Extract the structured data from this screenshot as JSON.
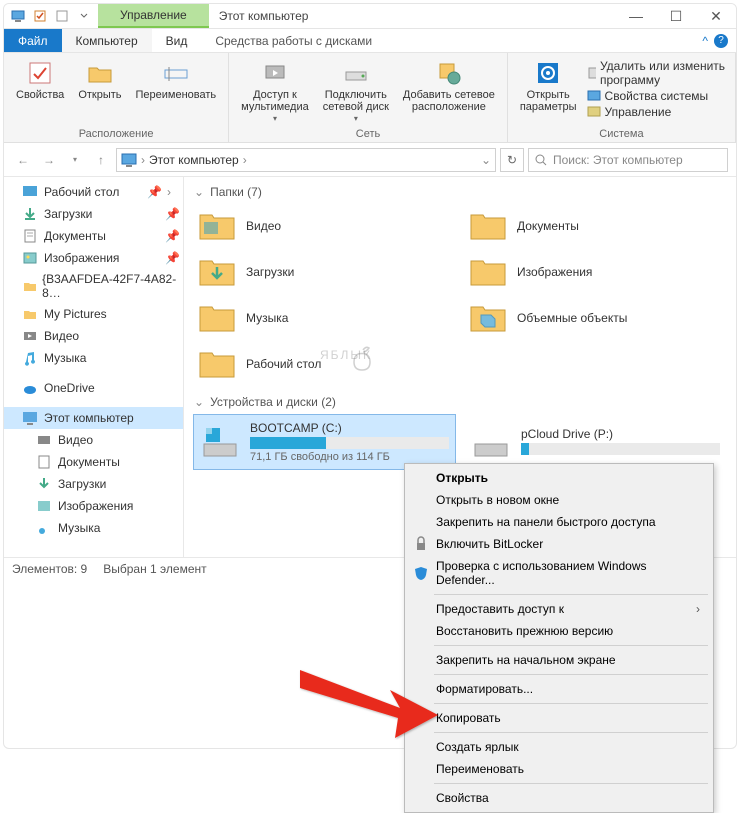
{
  "titlebar": {
    "manage_tab": "Управление",
    "title": "Этот компьютер"
  },
  "tabs": {
    "file": "Файл",
    "computer": "Компьютер",
    "view": "Вид",
    "disk_tools": "Средства работы с дисками"
  },
  "ribbon": {
    "group_location": "Расположение",
    "properties": "Свойства",
    "open": "Открыть",
    "rename": "Переименовать",
    "group_network": "Сеть",
    "multimedia": "Доступ к\nмультимедиа",
    "map_drive": "Подключить\nсетевой диск",
    "add_network": "Добавить сетевое\nрасположение",
    "group_system": "Система",
    "open_params": "Открыть\nпараметры",
    "sys_remove": "Удалить или изменить программу",
    "sys_props": "Свойства системы",
    "sys_manage": "Управление"
  },
  "nav": {
    "crumb": "Этот компьютер",
    "search_placeholder": "Поиск: Этот компьютер"
  },
  "sidebar": {
    "items": [
      {
        "label": "Рабочий стол",
        "icon": "desktop",
        "pinned": true
      },
      {
        "label": "Загрузки",
        "icon": "downloads",
        "pinned": true
      },
      {
        "label": "Документы",
        "icon": "documents",
        "pinned": true
      },
      {
        "label": "Изображения",
        "icon": "pictures",
        "pinned": true
      },
      {
        "label": "{B3AAFDEA-42F7-4A82-8…",
        "icon": "folder",
        "pinned": true
      },
      {
        "label": "My Pictures",
        "icon": "folder",
        "pinned": false
      },
      {
        "label": "Видео",
        "icon": "video",
        "pinned": false
      },
      {
        "label": "Музыка",
        "icon": "music",
        "pinned": false
      }
    ],
    "onedrive": "OneDrive",
    "this_pc": "Этот компьютер",
    "pc_children": [
      {
        "label": "Видео",
        "icon": "video"
      },
      {
        "label": "Документы",
        "icon": "documents"
      },
      {
        "label": "Загрузки",
        "icon": "downloads"
      },
      {
        "label": "Изображения",
        "icon": "pictures"
      },
      {
        "label": "Музыка",
        "icon": "music"
      }
    ]
  },
  "content": {
    "folders_header": "Папки (7)",
    "folders": [
      {
        "label": "Видео"
      },
      {
        "label": "Документы"
      },
      {
        "label": "Загрузки"
      },
      {
        "label": "Изображения"
      },
      {
        "label": "Музыка"
      },
      {
        "label": "Объемные объекты"
      },
      {
        "label": "Рабочий стол"
      }
    ],
    "drives_header": "Устройства и диски (2)",
    "drives": [
      {
        "name": "BOOTCAMP (C:)",
        "free": "71,1 ГБ свободно из 114 ГБ",
        "fill_pct": 38,
        "selected": true
      },
      {
        "name": "pCloud Drive (P:)",
        "free": "",
        "fill_pct": 4,
        "selected": false
      }
    ]
  },
  "status": {
    "count": "Элементов: 9",
    "selection": "Выбран 1 элемент"
  },
  "context_menu": {
    "open": "Открыть",
    "open_new": "Открыть в новом окне",
    "pin_quick": "Закрепить на панели быстрого доступа",
    "bitlocker": "Включить BitLocker",
    "defender": "Проверка с использованием Windows Defender...",
    "share": "Предоставить доступ к",
    "restore": "Восстановить прежнюю версию",
    "pin_start": "Закрепить на начальном экране",
    "format": "Форматировать...",
    "copy": "Копировать",
    "shortcut": "Создать ярлык",
    "rename": "Переименовать",
    "properties": "Свойства"
  },
  "watermark": "ЯБЛЫК"
}
